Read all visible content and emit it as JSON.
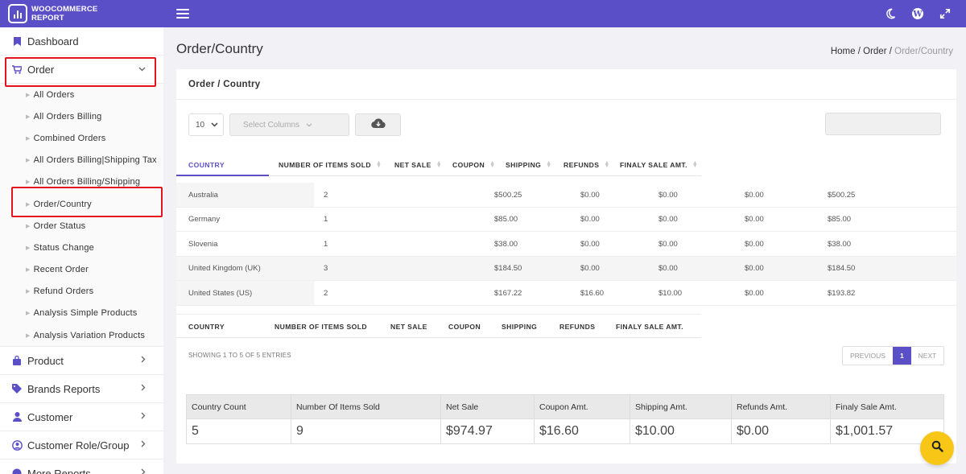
{
  "app": {
    "brand_line1": "WOOCOMMERCE",
    "brand_line2": "REPORT",
    "accent_color": "#5b4fc8",
    "highlight_color": "#e5131d",
    "top_icons": [
      "moon-icon",
      "wordpress-icon",
      "expand-icon"
    ]
  },
  "sidebar": {
    "dashboard": "Dashboard",
    "order": "Order",
    "order_subitems": [
      "All Orders",
      "All Orders Billing",
      "Combined Orders",
      "All Orders Billing|Shipping Tax",
      "All Orders Billing/Shipping",
      "Order/Country",
      "Order Status",
      "Status Change",
      "Recent Order",
      "Refund Orders",
      "Analysis Simple Products",
      "Analysis Variation Products"
    ],
    "product": "Product",
    "brands": "Brands Reports",
    "customer": "Customer",
    "customer_role": "Customer Role/Group",
    "more": "More Reports"
  },
  "page": {
    "title": "Order/Country",
    "breadcrumb_home": "Home",
    "breadcrumb_sep": "/",
    "breadcrumb_order": "Order",
    "breadcrumb_current": "Order/Country"
  },
  "card": {
    "title": "Order / Country",
    "page_length": "10",
    "select_columns_placeholder": "Select Columns",
    "search_value": ""
  },
  "table": {
    "headers": [
      "COUNTRY",
      "NUMBER OF ITEMS SOLD",
      "NET SALE",
      "COUPON",
      "SHIPPING",
      "REFUNDS",
      "FINALY SALE AMT."
    ],
    "rows": [
      [
        "Australia",
        "2",
        "$500.25",
        "$0.00",
        "$0.00",
        "$0.00",
        "$500.25"
      ],
      [
        "Germany",
        "1",
        "$85.00",
        "$0.00",
        "$0.00",
        "$0.00",
        "$85.00"
      ],
      [
        "Slovenia",
        "1",
        "$38.00",
        "$0.00",
        "$0.00",
        "$0.00",
        "$38.00"
      ],
      [
        "United Kingdom (UK)",
        "3",
        "$184.50",
        "$0.00",
        "$0.00",
        "$0.00",
        "$184.50"
      ],
      [
        "United States (US)",
        "2",
        "$167.22",
        "$16.60",
        "$10.00",
        "$0.00",
        "$193.82"
      ]
    ],
    "info": "SHOWING 1 TO 5 OF 5 ENTRIES",
    "pager": {
      "previous": "PREVIOUS",
      "current": "1",
      "next": "NEXT"
    }
  },
  "summary": {
    "headers": [
      "Country Count",
      "Number Of Items Sold",
      "Net Sale",
      "Coupon Amt.",
      "Shipping Amt.",
      "Refunds Amt.",
      "Finaly Sale Amt."
    ],
    "values": [
      "5",
      "9",
      "$974.97",
      "$16.60",
      "$10.00",
      "$0.00",
      "$1,001.57"
    ]
  }
}
